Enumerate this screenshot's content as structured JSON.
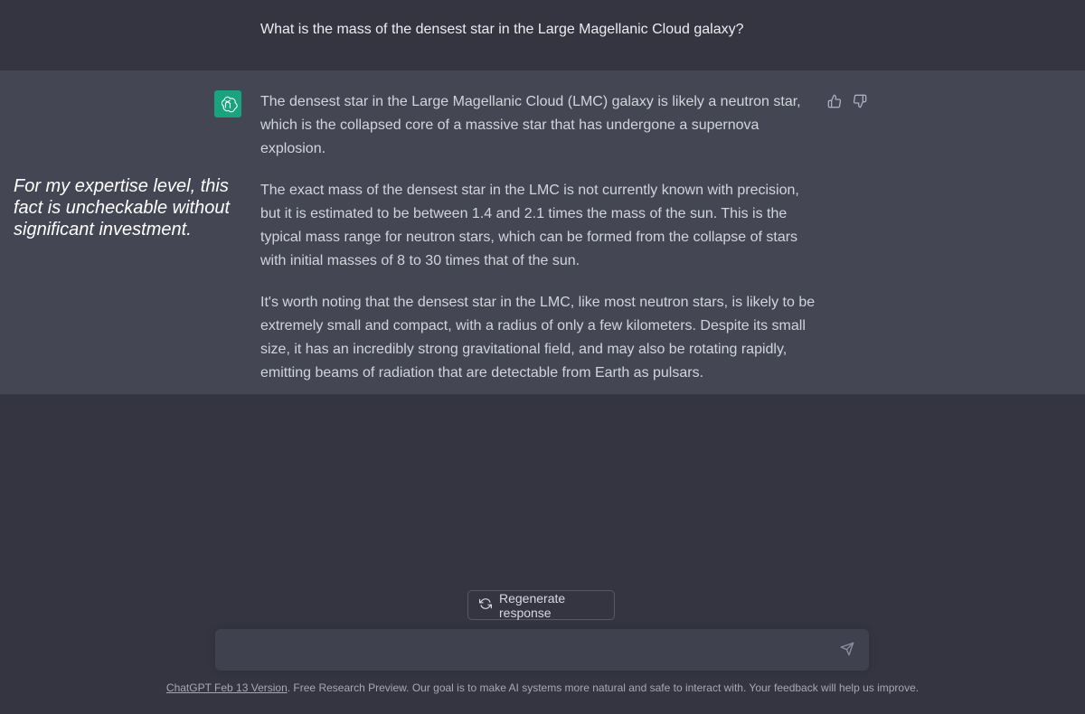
{
  "conversation": {
    "user_message": "What is the mass of the densest star in the Large Magellanic Cloud galaxy?",
    "assistant_paragraphs": [
      "The densest star in the Large Magellanic Cloud (LMC) galaxy is likely a neutron star, which is the collapsed core of a massive star that has undergone a supernova explosion.",
      "The exact mass of the densest star in the LMC is not currently known with precision, but it is estimated to be between 1.4 and 2.1 times the mass of the sun. This is the typical mass range for neutron stars, which can be formed from the collapse of stars with initial masses of 8 to 30 times that of the sun.",
      "It's worth noting that the densest star in the LMC, like most neutron stars, is likely to be extremely small and compact, with a radius of only a few kilometers. Despite its small size, it has an incredibly strong gravitational field, and may also be rotating rapidly, emitting beams of radiation that are detectable from Earth as pulsars."
    ]
  },
  "annotation": {
    "text": "For my expertise level, this fact is uncheckable without significant investment."
  },
  "controls": {
    "regenerate_label": "Regenerate response",
    "input_value": "",
    "icons": {
      "avatar": "openai-logo-icon",
      "thumbs_up": "thumbs-up-icon",
      "thumbs_down": "thumbs-down-icon",
      "regenerate": "refresh-icon",
      "send": "send-icon"
    }
  },
  "footer": {
    "link_text": "ChatGPT Feb 13 Version",
    "text": ". Free Research Preview. Our goal is to make AI systems more natural and safe to interact with. Your feedback will help us improve."
  },
  "colors": {
    "background": "#343541",
    "assistant_background": "#444654",
    "avatar": "#19a37f",
    "composer": "#40414f"
  }
}
